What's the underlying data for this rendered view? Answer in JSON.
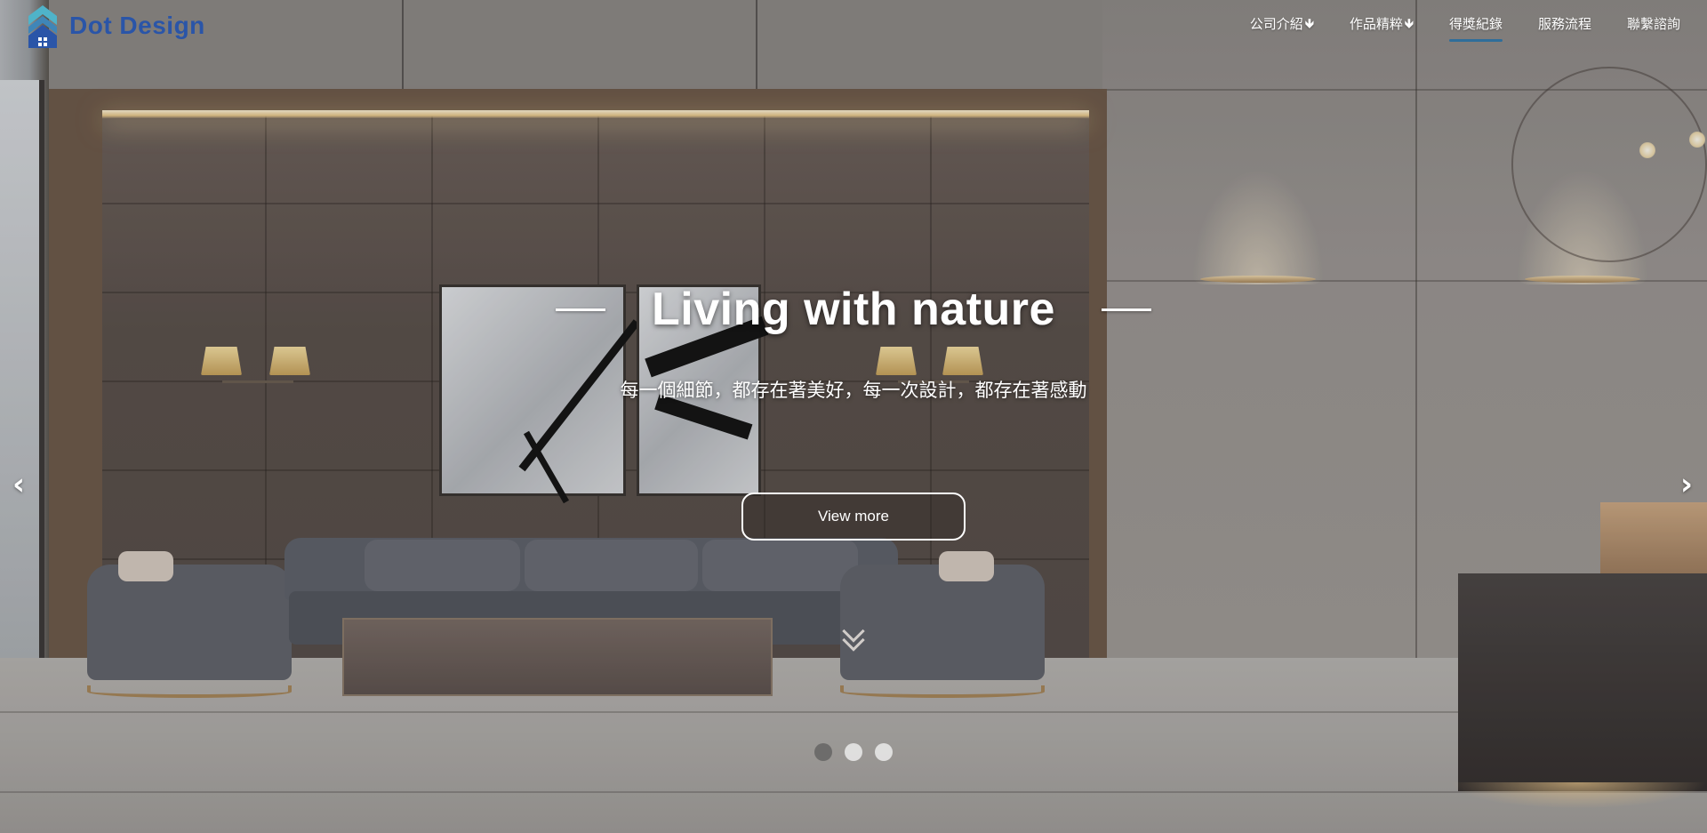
{
  "brand": {
    "name": "Dot Design",
    "logo_icon": "house-logo-icon",
    "colors": {
      "brand": "#2a55a8",
      "mark_top": "#4fb3c9",
      "mark_bottom": "#2a55a8",
      "nav_active_underline": "#2f6e9a"
    }
  },
  "nav": {
    "items": [
      {
        "label": "公司介紹",
        "arrow": "🡻",
        "active": false
      },
      {
        "label": "作品精粹",
        "arrow": "🡻",
        "active": false
      },
      {
        "label": "得獎紀錄",
        "arrow": "",
        "active": true
      },
      {
        "label": "服務流程",
        "arrow": "",
        "active": false
      },
      {
        "label": "聯繫諮詢",
        "arrow": "",
        "active": false
      }
    ]
  },
  "hero": {
    "title": "Living with nature",
    "subtitle": "每一個細節，都存在著美好，每一次設計，都存在著感動",
    "cta_label": "View more",
    "prev_arrow": "‹",
    "next_arrow": "›",
    "scroll_icon": "double-chevron-down-icon"
  },
  "carousel": {
    "slide_count": 3,
    "active_index": 0
  }
}
